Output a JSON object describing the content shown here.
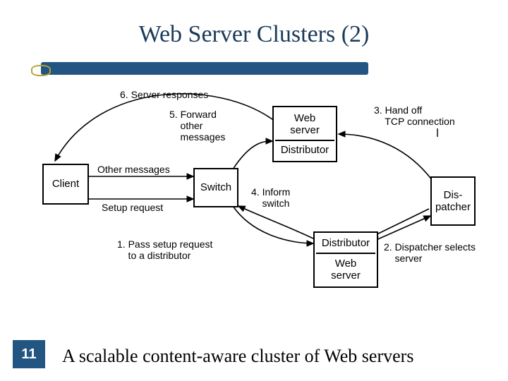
{
  "title": "Web Server Clusters (2)",
  "caption": "A scalable content-aware cluster of Web servers",
  "page_number": "11",
  "nodes": {
    "client": "Client",
    "switch": "Switch",
    "web_server_top": "Web\nserver",
    "distributor_top": "Distributor",
    "distributor_bottom": "Distributor",
    "web_server_bottom": "Web\nserver",
    "dispatcher": "Dis-\npatcher"
  },
  "labels": {
    "l1": "1. Pass setup request\n    to a distributor",
    "l2": "2. Dispatcher selects\n    server",
    "l3": "3. Hand off\n    TCP connection",
    "l4": "4. Inform\n    switch",
    "l5": "5. Forward\n    other\n    messages",
    "l6": "6. Server responses",
    "other": "Other messages",
    "setup": "Setup request"
  }
}
